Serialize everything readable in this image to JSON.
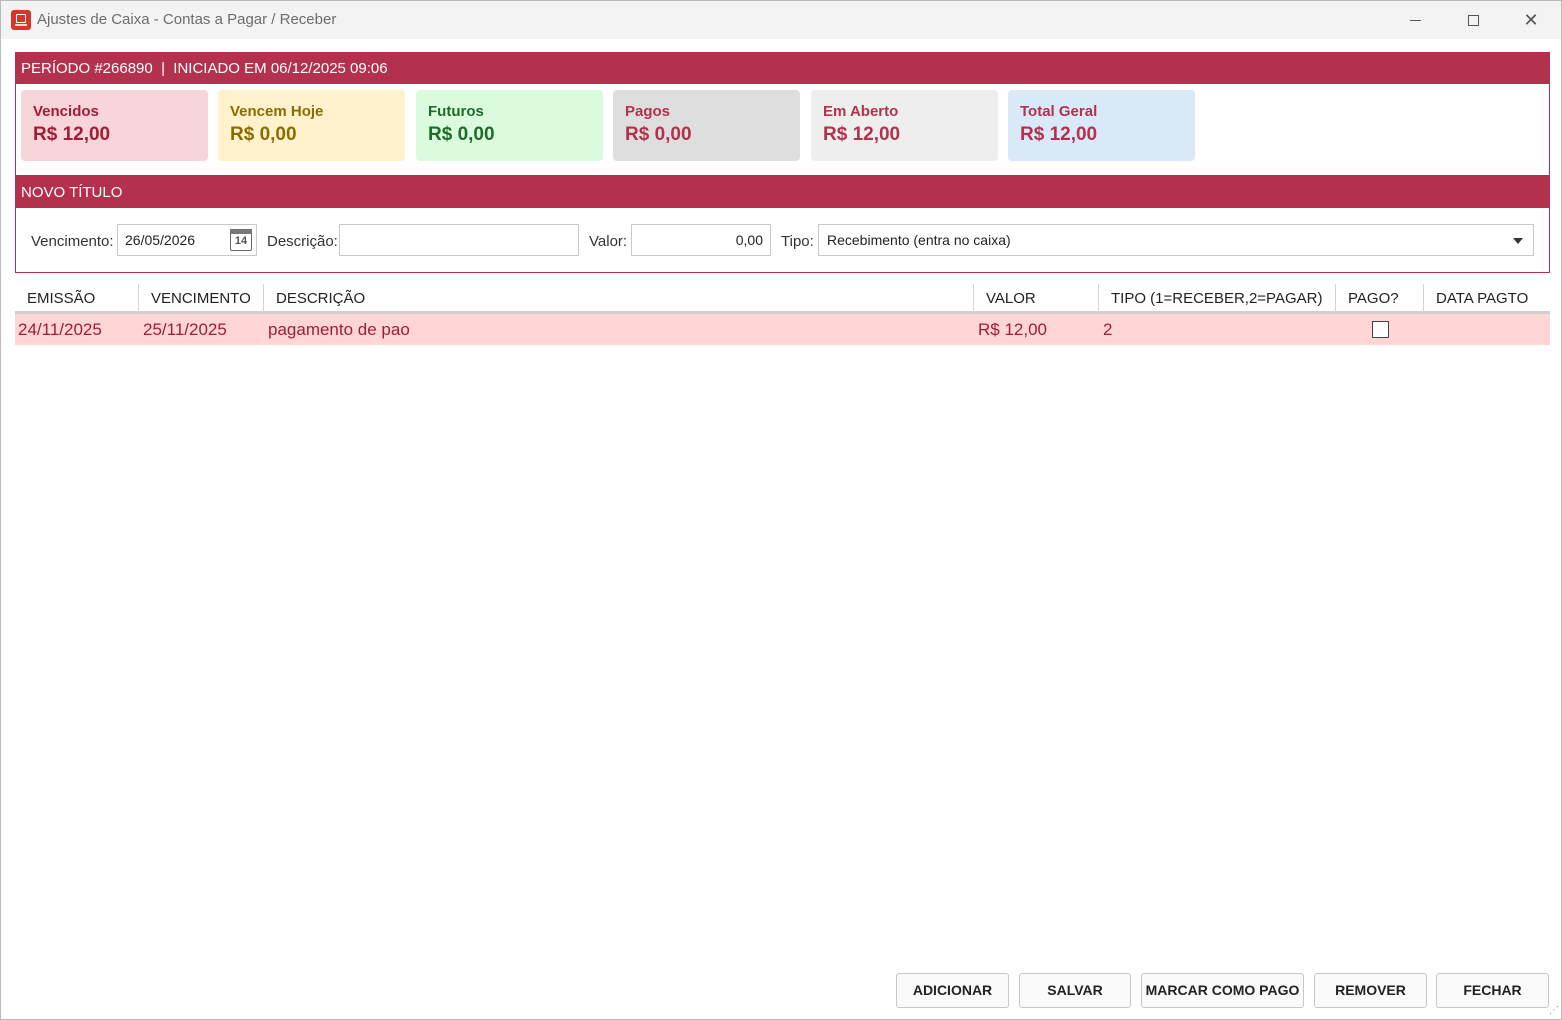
{
  "window": {
    "title": "Ajustes de Caixa - Contas a Pagar / Receber"
  },
  "periodo": {
    "header": "PERÍODO #266890  |  INICIADO EM 06/12/2025 09:06"
  },
  "cards": [
    {
      "label": "Vencidos",
      "value": "R$ 12,00",
      "bg": "#f8d5da",
      "color": "#a11c35"
    },
    {
      "label": "Vencem Hoje",
      "value": "R$ 0,00",
      "bg": "#fff2cc",
      "color": "#8a6d00"
    },
    {
      "label": "Futuros",
      "value": "R$ 0,00",
      "bg": "#dbfbdf",
      "color": "#1f6b2b"
    },
    {
      "label": "Pagos",
      "value": "R$ 0,00",
      "bg": "#dedede",
      "color": "#b3314d"
    },
    {
      "label": "Em Aberto",
      "value": "R$ 12,00",
      "bg": "#eeeeee",
      "color": "#b3314d"
    },
    {
      "label": "Total Geral",
      "value": "R$ 12,00",
      "bg": "#d9e9f7",
      "color": "#b3314d"
    }
  ],
  "novo": {
    "header": "NOVO TÍTULO",
    "vencimento_label": "Vencimento:",
    "vencimento_value": "26/05/2026",
    "calendar_day": "14",
    "descricao_label": "Descrição:",
    "descricao_value": "",
    "valor_label": "Valor:",
    "valor_value": "0,00",
    "tipo_label": "Tipo:",
    "tipo_value": "Recebimento (entra no caixa)"
  },
  "grid": {
    "columns": [
      "EMISSÃO",
      "VENCIMENTO",
      "DESCRIÇÃO",
      "VALOR",
      "TIPO (1=RECEBER,2=PAGAR)",
      "PAGO?",
      "DATA PAGTO"
    ],
    "rows": [
      {
        "emissao": "24/11/2025",
        "vencimento": "25/11/2025",
        "descricao": "pagamento de pao",
        "valor": "R$ 12,00",
        "tipo": "2",
        "pago": false,
        "data_pagto": ""
      }
    ]
  },
  "buttons": {
    "adicionar": "ADICIONAR",
    "salvar": "SALVAR",
    "marcar_pago": "MARCAR COMO PAGO",
    "remover": "REMOVER",
    "fechar": "FECHAR"
  },
  "colors": {
    "accent": "#b3314d",
    "row_highlight": "#ffd6d6"
  },
  "icons": {
    "app": "cash-register-icon",
    "calendar": "calendar-icon",
    "dropdown": "chevron-down-icon"
  }
}
